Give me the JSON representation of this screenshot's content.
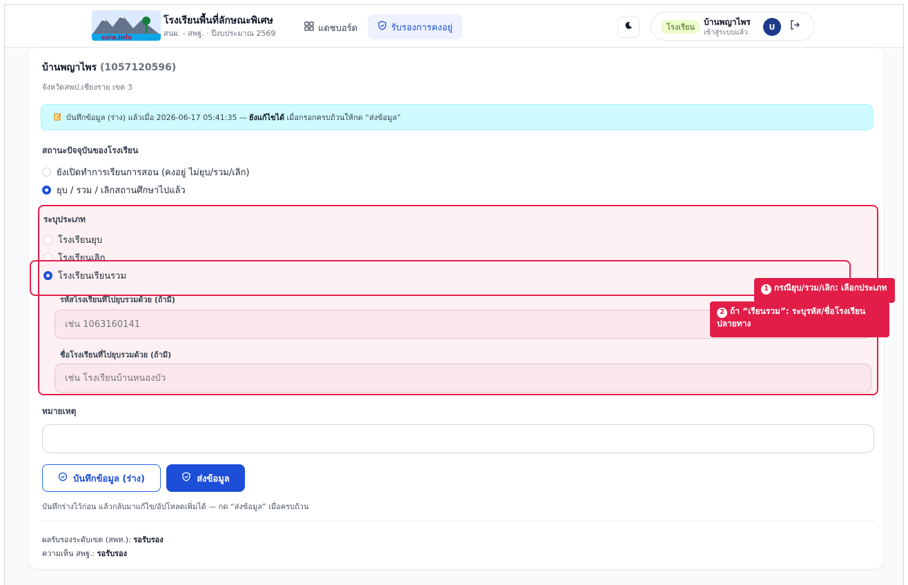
{
  "header": {
    "app_title": "โรงเรียนพื้นที่ลักษณะพิเศษ",
    "app_subtitle": "สนผ. - สพฐ. · ปีงบประมาณ 2569",
    "logo_text": "ssra.info",
    "nav_dashboard": "แดชบอร์ด",
    "nav_confirm": "รับรองการคงอยู่",
    "role_badge": "โรงเรียน",
    "user_name": "บ้านพญาไพร",
    "user_status": "เข้าสู่ระบบแล้ว",
    "avatar_initial": "U"
  },
  "school": {
    "name": "บ้านพญาไพร",
    "code": "(1057120596)",
    "region": "จังหวัดสพป.เชียงราย เขต 3"
  },
  "banner": {
    "prefix": "บันทึกข้อมูล (ร่าง) แล้วเมื่อ 2026-06-17 05:41:35 —",
    "bold": "ยังแก้ไขได้",
    "suffix": "เมื่อกรอกครบถ้วนให้กด “ส่งข้อมูล”"
  },
  "status": {
    "label": "สถานะปัจจุบันของโรงเรียน",
    "option_open": "ยังเปิดทำการเรียนการสอน (คงอยู่ ไม่ยุบ/รวม/เลิก)",
    "option_closed": "ยุบ / รวม / เลิกสถานศึกษาไปแล้ว"
  },
  "type": {
    "label": "ระบุประเภท",
    "option_dissolved": "โรงเรียนยุบ",
    "option_ended": "โรงเรียนเลิก",
    "option_merged": "โรงเรียนเรียนรวม",
    "merge_code_label": "รหัสโรงเรียนที่ไปยุบรวมด้วย (ถ้ามี)",
    "merge_code_placeholder": "เช่น 1063160141",
    "merge_name_label": "ชื่อโรงเรียนที่ไปยุบรวมด้วย (ถ้ามี)",
    "merge_name_placeholder": "เช่น โรงเรียนบ้านหนองบัว"
  },
  "callouts": {
    "one_num": "1",
    "one_text": "กรณียุบ/รวม/เลิก: เลือกประเภท",
    "two_num": "2",
    "two_text": "ถ้า “เรียนรวม”: ระบุรหัส/ชื่อโรงเรียนปลายทาง"
  },
  "notes": {
    "label": "หมายเหตุ",
    "value": ""
  },
  "actions": {
    "draft_label": "บันทึกข้อมูล (ร่าง)",
    "submit_label": "ส่งข้อมูล",
    "help_text": "บันทึกร่างไว้ก่อน แล้วกลับมาแก้ไข/อัปโหลดเพิ่มได้ — กด “ส่งข้อมูล” เมื่อครบถ้วน"
  },
  "results": {
    "district_label": "ผลรับรองระดับเขต (สพท.):",
    "district_value": "รอรับรอง",
    "obec_label": "ความเห็น สพฐ.:",
    "obec_value": "รอรับรอง"
  },
  "colors": {
    "primary": "#1d4ed8",
    "highlight": "#e11d48",
    "banner_bg": "#cffafe"
  }
}
